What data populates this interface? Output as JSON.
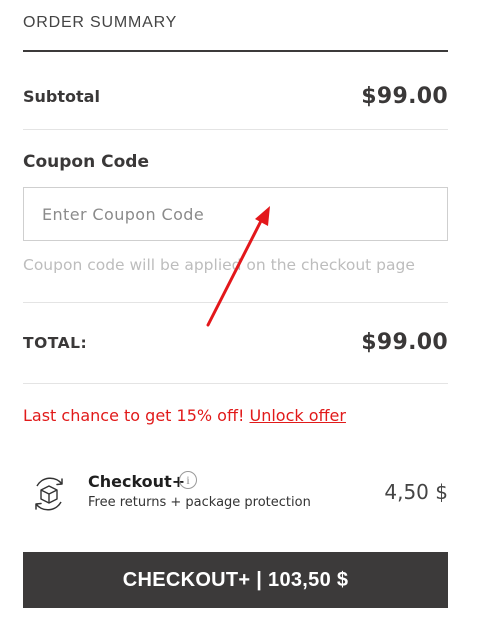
{
  "order_summary": {
    "title": "ORDER SUMMARY"
  },
  "subtotal": {
    "label": "Subtotal",
    "value": "$99.00"
  },
  "coupon": {
    "label": "Coupon Code",
    "placeholder": "Enter Coupon Code",
    "value": "",
    "help": "Coupon code will be applied on the checkout page"
  },
  "total": {
    "label": "TOTAL:",
    "value": "$99.00"
  },
  "offer": {
    "text": "Last chance to get 15% off!",
    "link": "Unlock offer"
  },
  "addon": {
    "icon": "package-protection-icon",
    "title": "Checkout+",
    "info_glyph": "i",
    "subtitle": "Free returns + package protection",
    "price": "4,50 $"
  },
  "checkout_button": {
    "label": "CHECKOUT+ | 103,50 $"
  },
  "colors": {
    "dark": "#3c3a3a",
    "offer_red": "#e11a1a",
    "annotation_red": "#e3171b"
  }
}
